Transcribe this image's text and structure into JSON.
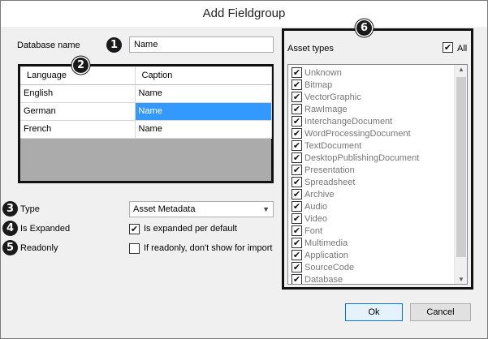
{
  "window": {
    "title": "Add Fieldgroup"
  },
  "callouts": {
    "c1": "1",
    "c2": "2",
    "c3": "3",
    "c4": "4",
    "c5": "5",
    "c6": "6"
  },
  "database_name": {
    "label": "Database name",
    "value": "Name"
  },
  "captions": {
    "columns": [
      "Language",
      "Caption"
    ],
    "rows": [
      {
        "language": "English",
        "caption": "Name"
      },
      {
        "language": "German",
        "caption": "Name"
      },
      {
        "language": "French",
        "caption": "Name"
      }
    ],
    "selected_row": 1
  },
  "type": {
    "label": "Type",
    "value": "Asset Metadata"
  },
  "is_expanded": {
    "label": "Is Expanded",
    "checkbox_label": "Is expanded per default",
    "checked": true
  },
  "readonly": {
    "label": "Readonly",
    "checkbox_label": "If readonly, don't show for import",
    "checked": false
  },
  "asset_types": {
    "label": "Asset types",
    "all_label": "All",
    "all_checked": true,
    "items": [
      "Unknown",
      "Bitmap",
      "VectorGraphic",
      "RawImage",
      "InterchangeDocument",
      "WordProcessingDocument",
      "TextDocument",
      "DesktopPublishingDocument",
      "Presentation",
      "Spreadsheet",
      "Archive",
      "Audio",
      "Video",
      "Font",
      "Multimedia",
      "Application",
      "SourceCode",
      "Database"
    ]
  },
  "buttons": {
    "ok": "Ok",
    "cancel": "Cancel"
  },
  "icons": {
    "check": "check-icon",
    "dropdown": "chevron-down-icon",
    "scroll_up": "scroll-up-icon",
    "scroll_down": "scroll-down-icon"
  }
}
